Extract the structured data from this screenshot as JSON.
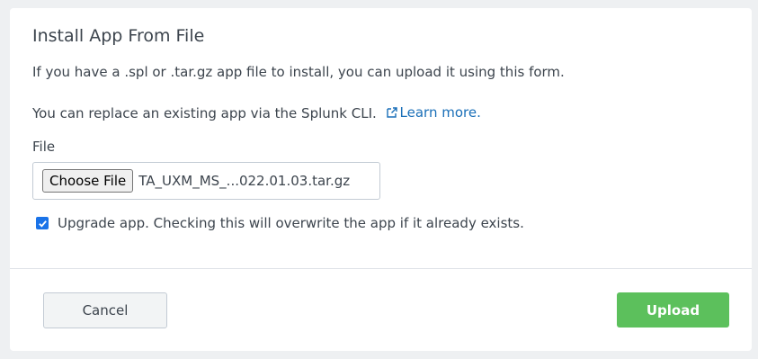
{
  "modal": {
    "title": "Install App From File",
    "intro_text": "If you have a .spl or .tar.gz app file to install, you can upload it using this form.",
    "replace_text": "You can replace an existing app via the Splunk CLI.",
    "learn_more_label": "Learn more.",
    "file_label": "File",
    "choose_file_label": "Choose File",
    "file_name": "TA_UXM_MS_...022.01.03.tar.gz",
    "upgrade_checked": true,
    "upgrade_label": "Upgrade app. Checking this will overwrite the app if it already exists."
  },
  "footer": {
    "cancel_label": "Cancel",
    "upload_label": "Upload"
  },
  "colors": {
    "link": "#1a6fb8",
    "upload_button": "#5cc05c",
    "checkbox": "#1a73e8"
  },
  "icons": {
    "external_link": "external-link-icon",
    "checkbox": "checkmark-icon"
  }
}
